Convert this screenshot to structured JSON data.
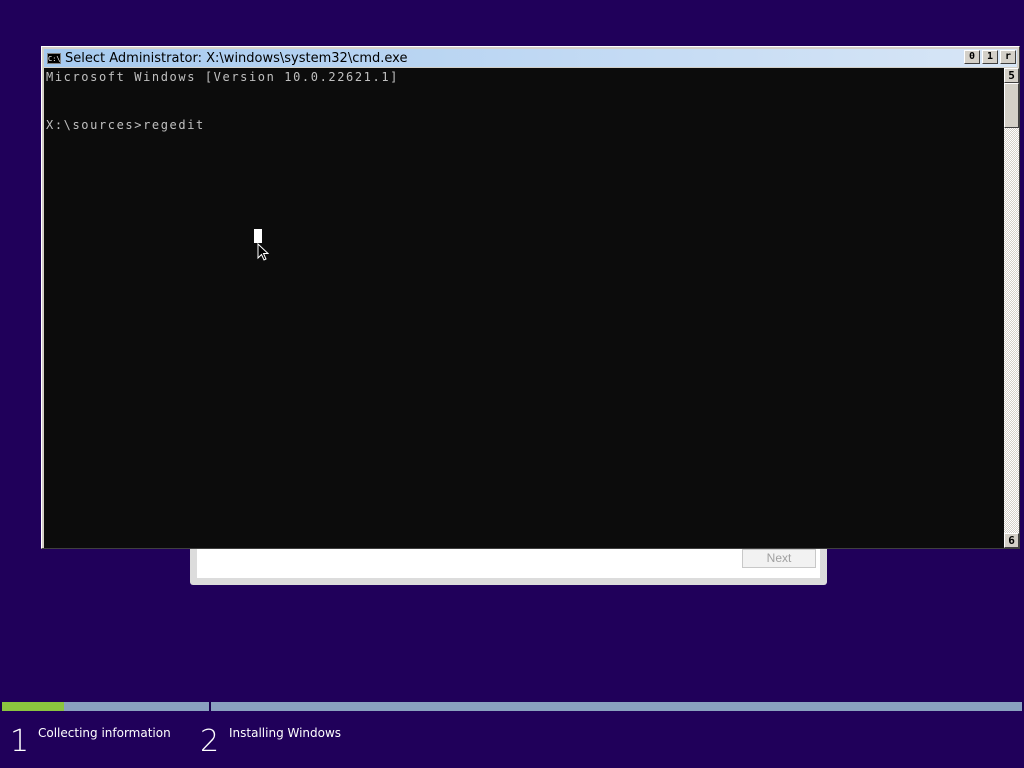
{
  "colors": {
    "background": "#20005a",
    "console_bg": "#0c0c0c",
    "console_text": "#c0c0c0",
    "progress_done": "#8bc53f",
    "progress_pending": "#8aa0c0"
  },
  "setup_dialog": {
    "next_label": "Next"
  },
  "cmd_window": {
    "title": "Select Administrator: X:\\windows\\system32\\cmd.exe",
    "app_icon": "C:\\",
    "controls": {
      "minimize": "0",
      "maximize": "1",
      "close": "r"
    },
    "console_lines": [
      "Microsoft Windows [Version 10.0.22621.1]",
      "X:\\sources>regedit"
    ],
    "scroll_up": "5",
    "scroll_down": "6"
  },
  "progress": {
    "fraction_of_step1": 0.3
  },
  "steps": [
    {
      "number": "1",
      "label": "Collecting information"
    },
    {
      "number": "2",
      "label": "Installing Windows"
    }
  ]
}
